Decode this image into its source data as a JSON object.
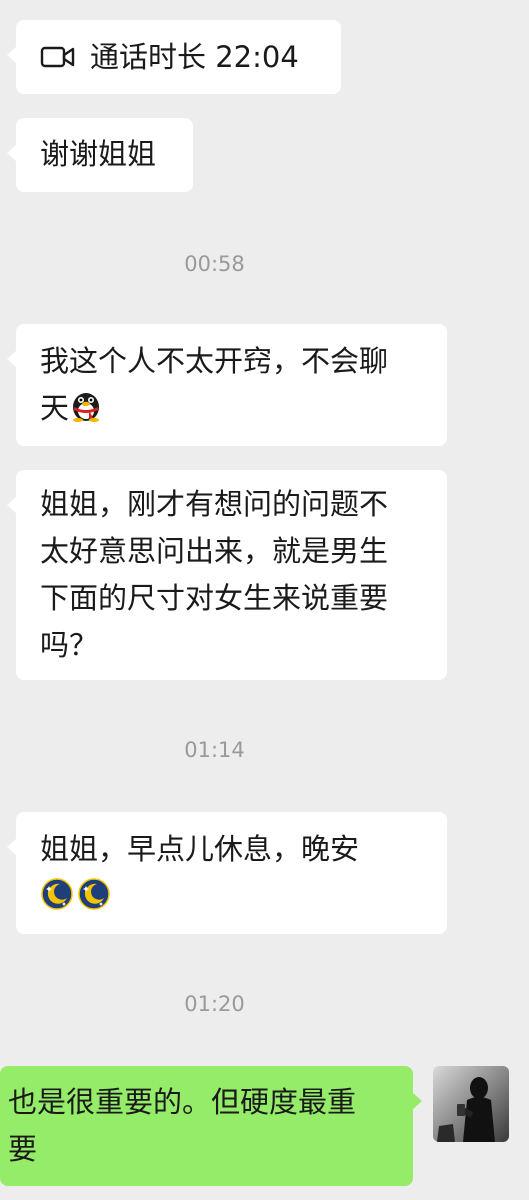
{
  "messages": {
    "call": {
      "icon": "video-call-icon",
      "label": "通话时长 22:04"
    },
    "m1": {
      "text": "谢谢姐姐"
    },
    "ts1": "00:58",
    "m2": {
      "line1": "我这个人不太开窍，不会聊",
      "line2": "天",
      "emoji": "qq-penguin-emoji"
    },
    "m3": {
      "line1": "姐姐，刚才有想问的问题不",
      "line2": "太好意思问出来，就是男生",
      "line3": "下面的尺寸对女生来说重要",
      "line4": "吗？"
    },
    "ts2": "01:14",
    "m4": {
      "line1": "姐姐，早点儿休息，晚安",
      "emoji": "sleepy-moon-emoji"
    },
    "ts3": "01:20",
    "m5": {
      "line1": "也是很重要的。但硬度最重",
      "line2": "要"
    }
  },
  "colors": {
    "background": "#ededed",
    "incoming_bubble": "#ffffff",
    "outgoing_bubble": "#95ec69",
    "timestamp_text": "#9a9a9a"
  },
  "avatar": {
    "icon": "user-avatar-silhouette"
  }
}
